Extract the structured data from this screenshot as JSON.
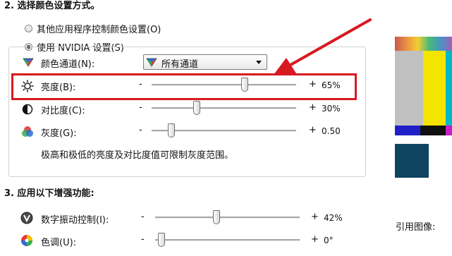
{
  "section2": {
    "heading": "2. 选择颜色设置方式。",
    "option_other": "其他应用程序控制颜色设置(O)",
    "option_nvidia": "使用 NVIDIA 设置(S)",
    "channel_label": "颜色通道(N):",
    "channel_value": "所有通道",
    "sliders": [
      {
        "label": "亮度(B):",
        "value_text": "65%",
        "level_pct": 65
      },
      {
        "label": "对比度(C):",
        "value_text": "30%",
        "level_pct": 30
      },
      {
        "label": "灰度(G):",
        "value_text": "0.50",
        "level_pct": 12
      }
    ],
    "note": "极高和极低的亮度及对比度值可限制灰度范围。"
  },
  "section3": {
    "heading": "3. 应用以下增强功能:",
    "sliders": [
      {
        "label": "数字振动控制(I):",
        "value_text": "42%",
        "level_pct": 42
      },
      {
        "label": "色调(U):",
        "value_text": "0°",
        "level_pct": 2
      }
    ]
  },
  "slider_minus": "-",
  "slider_plus": "+",
  "reference_label": "引用图像:",
  "colors": {
    "highlight": "#d71920",
    "arrow": "#d71920"
  }
}
